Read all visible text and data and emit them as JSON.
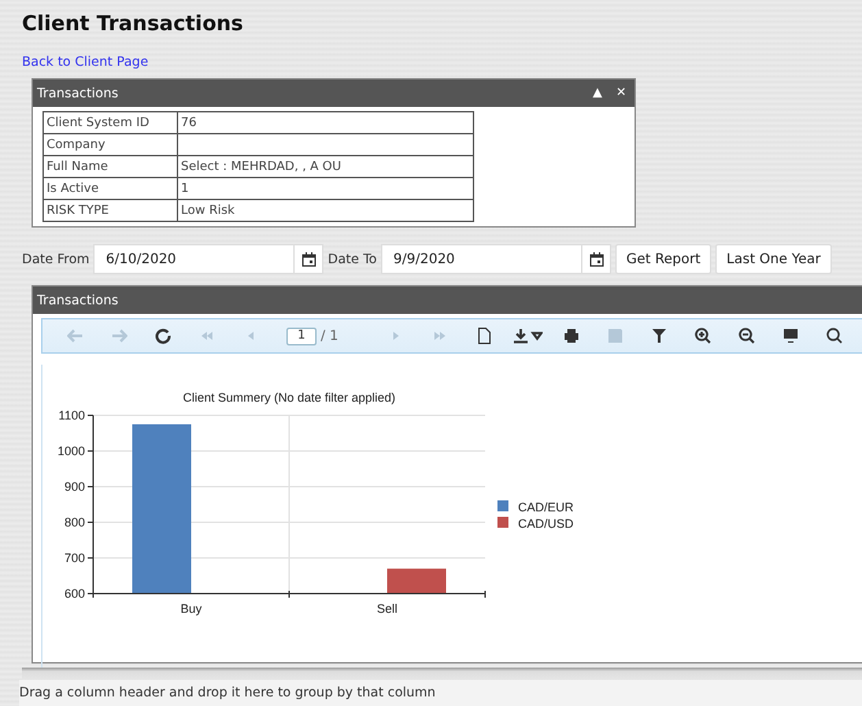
{
  "page_title": "Client Transactions",
  "back_link": "Back to Client Page",
  "info_panel": {
    "title": "Transactions",
    "collapse_icon": "▲",
    "close_icon": "✕",
    "rows": [
      {
        "label": "Client System ID",
        "value": "76"
      },
      {
        "label": "Company",
        "value": ""
      },
      {
        "label": "Full Name",
        "value": "Select : MEHRDAD, , A OU"
      },
      {
        "label": "Is Active",
        "value": "1"
      },
      {
        "label": "RISK TYPE",
        "value": "Low Risk"
      }
    ]
  },
  "filters": {
    "date_from_label": "Date From",
    "date_from": "6/10/2020",
    "date_to_label": "Date To",
    "date_to": "9/9/2020",
    "buttons": [
      "Get Report",
      "Last One Year"
    ]
  },
  "report_panel": {
    "title": "Transactions",
    "toolbar": [
      {
        "kind": "back",
        "disabled": true
      },
      {
        "kind": "forward",
        "disabled": true
      },
      {
        "kind": "refresh",
        "disabled": false
      },
      {
        "kind": "first",
        "disabled": true
      },
      {
        "kind": "prev",
        "disabled": true
      },
      {
        "kind": "page",
        "value": "1",
        "total": "/ 1"
      },
      {
        "kind": "next",
        "disabled": true
      },
      {
        "kind": "last",
        "disabled": true
      },
      {
        "kind": "document",
        "disabled": false
      },
      {
        "kind": "export",
        "disabled": false
      },
      {
        "kind": "print",
        "disabled": false
      },
      {
        "kind": "save",
        "disabled": true
      },
      {
        "kind": "filter",
        "disabled": false
      },
      {
        "kind": "zoomin",
        "disabled": false
      },
      {
        "kind": "zoomout",
        "disabled": false
      },
      {
        "kind": "monitor",
        "disabled": false
      },
      {
        "kind": "search",
        "disabled": false
      }
    ],
    "chart_data": {
      "type": "bar",
      "title": "Client Summery (No date filter applied)",
      "categories": [
        "Buy",
        "Sell"
      ],
      "series": [
        {
          "name": "CAD/EUR",
          "color": "#4f81bd",
          "values": [
            1075,
            null
          ]
        },
        {
          "name": "CAD/USD",
          "color": "#c0504d",
          "values": [
            null,
            670
          ]
        }
      ],
      "ylim": [
        600,
        1100
      ],
      "yticks": [
        600,
        700,
        800,
        900,
        1000,
        1100
      ],
      "grid": true,
      "legend": true
    }
  },
  "group_hint": "Drag a column header and drop it here to group by that column"
}
